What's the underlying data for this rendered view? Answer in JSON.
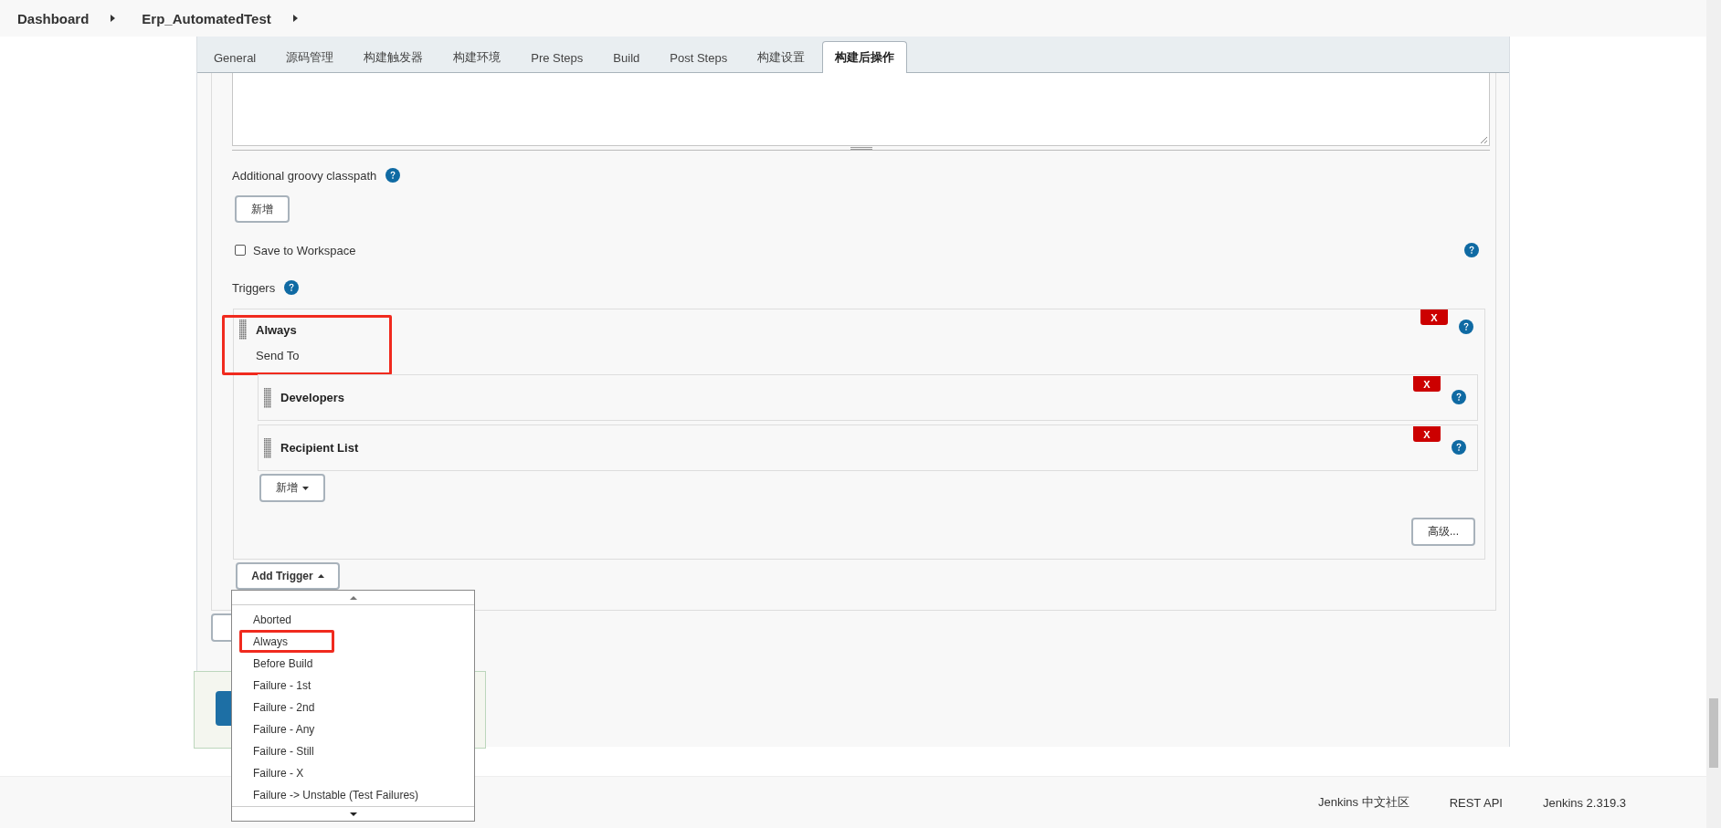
{
  "breadcrumb": [
    {
      "label": "Dashboard"
    },
    {
      "label": "Erp_AutomatedTest"
    }
  ],
  "tabs": [
    {
      "label": "General",
      "selected": false
    },
    {
      "label": "源码管理",
      "selected": false
    },
    {
      "label": "构建触发器",
      "selected": false
    },
    {
      "label": "构建环境",
      "selected": false
    },
    {
      "label": "Pre Steps",
      "selected": false
    },
    {
      "label": "Build",
      "selected": false
    },
    {
      "label": "Post Steps",
      "selected": false
    },
    {
      "label": "构建设置",
      "selected": false
    },
    {
      "label": "构建后操作",
      "selected": true
    }
  ],
  "classpath": {
    "label": "Additional groovy classpath",
    "button": "新增"
  },
  "save_to_workspace": {
    "label": "Save to Workspace",
    "checked": false
  },
  "triggers": {
    "label": "Triggers",
    "add_button": "Add Trigger",
    "items": [
      {
        "title": "Always",
        "highlighted": true,
        "remove_label": "X",
        "send_to_label": "Send To",
        "add_button": "新增",
        "advanced_button": "高级...",
        "recipients": [
          {
            "label": "Developers",
            "remove_label": "X"
          },
          {
            "label": "Recipient List",
            "remove_label": "X"
          }
        ]
      }
    ]
  },
  "trigger_menu": {
    "items": [
      {
        "label": "Aborted",
        "highlighted": false
      },
      {
        "label": "Always",
        "highlighted": true
      },
      {
        "label": "Before Build",
        "highlighted": false
      },
      {
        "label": "Failure - 1st",
        "highlighted": false
      },
      {
        "label": "Failure - 2nd",
        "highlighted": false
      },
      {
        "label": "Failure - Any",
        "highlighted": false
      },
      {
        "label": "Failure - Still",
        "highlighted": false
      },
      {
        "label": "Failure - X",
        "highlighted": false
      },
      {
        "label": "Failure -> Unstable (Test Failures)",
        "highlighted": false
      }
    ]
  },
  "footer": {
    "links": [
      "Jenkins 中文社区",
      "REST API",
      "Jenkins 2.319.3"
    ]
  }
}
